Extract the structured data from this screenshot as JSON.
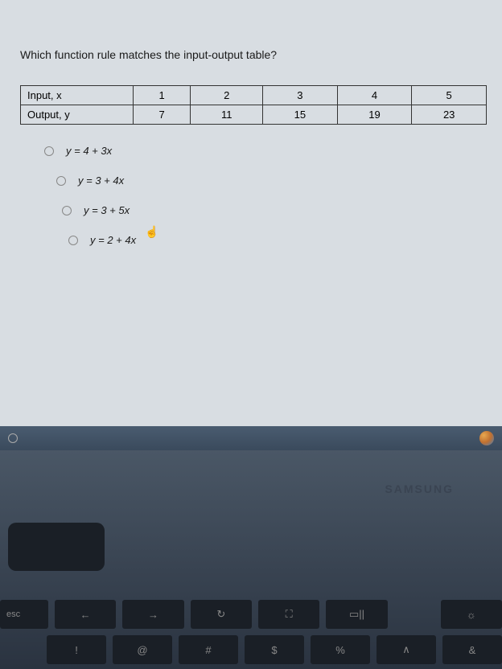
{
  "question": "Which function rule matches the input-output table?",
  "table": {
    "rows": [
      {
        "label": "Input, x",
        "v1": "1",
        "v2": "2",
        "v3": "3",
        "v4": "4",
        "v5": "5"
      },
      {
        "label": "Output, y",
        "v1": "7",
        "v2": "11",
        "v3": "15",
        "v4": "19",
        "v5": "23"
      }
    ]
  },
  "options": {
    "a": "y = 4 + 3x",
    "b": "y = 3 + 4x",
    "c": "y = 3 + 5x",
    "d": "y = 2 + 4x"
  },
  "brand": "SAMSUNG",
  "keys": {
    "row1": {
      "esc": "esc",
      "back": "←",
      "fwd": "→",
      "reload": "↻",
      "full": "⛶",
      "switch": "▭||",
      "bright": "☼"
    },
    "row2": {
      "k1": "!",
      "k2": "@",
      "k3": "#",
      "k4": "$",
      "k5": "%",
      "k6": "∧",
      "k7": "&"
    }
  }
}
